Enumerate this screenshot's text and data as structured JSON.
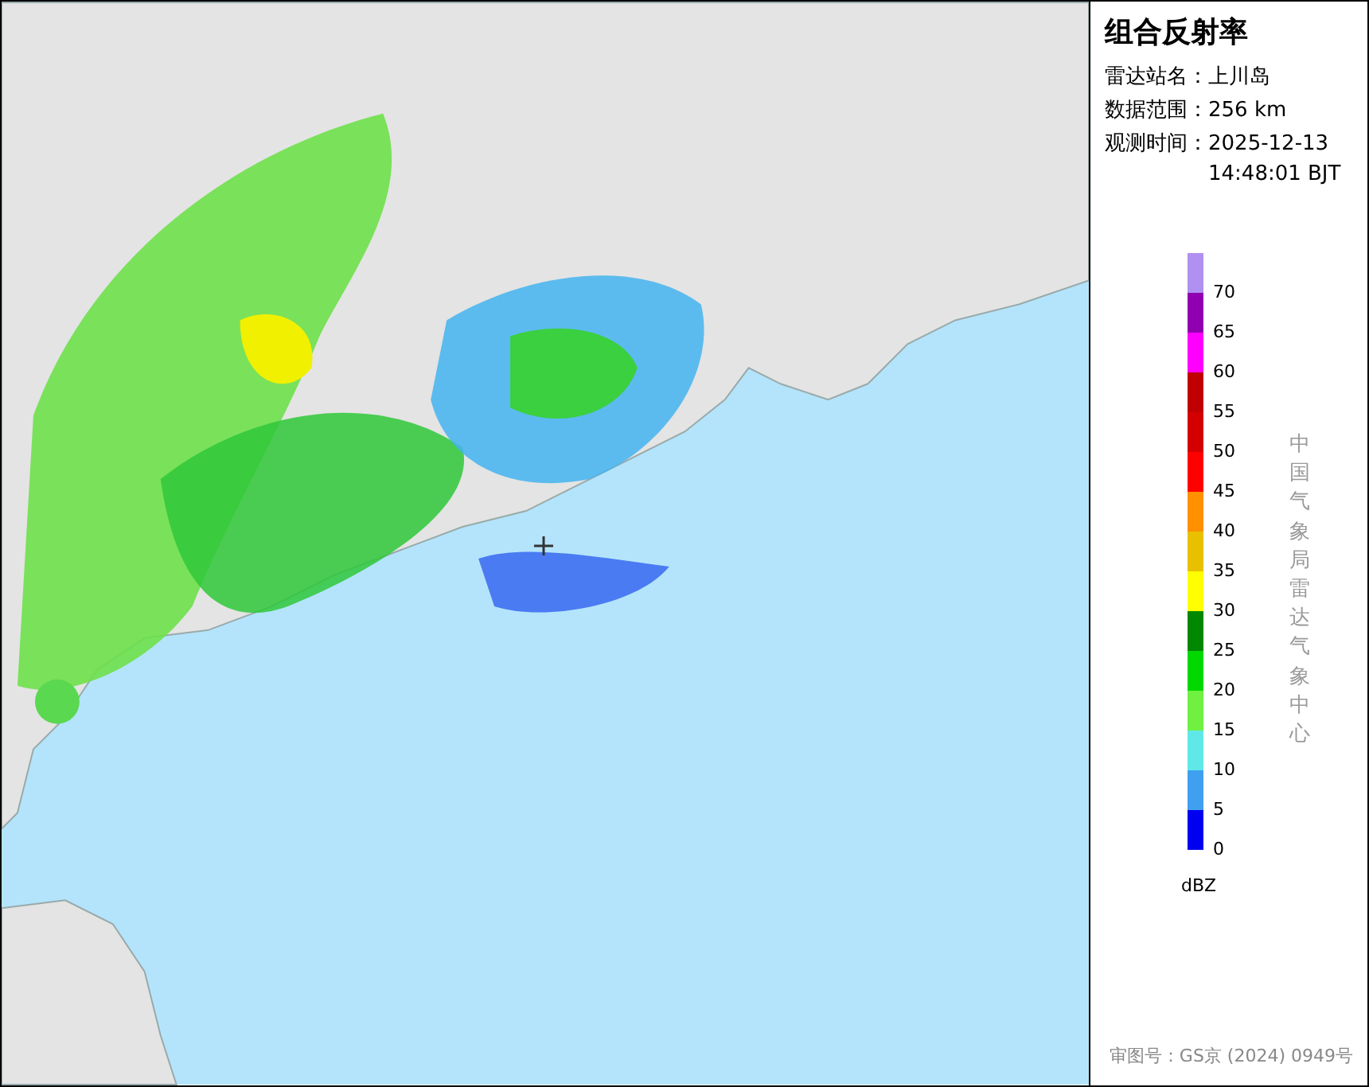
{
  "panel": {
    "title": "组合反射率",
    "info": [
      {
        "label": "雷达站名：",
        "value": "上川岛"
      },
      {
        "label": "数据范围：",
        "value": "256 km"
      },
      {
        "label": "观测时间：",
        "value": "2025-12-13 14:48:01 BJT"
      }
    ],
    "legend": {
      "bins": [
        {
          "color": "#b090f0"
        },
        {
          "color": "#9000b0"
        },
        {
          "color": "#ff00ff"
        },
        {
          "color": "#c00000"
        },
        {
          "color": "#d40000"
        },
        {
          "color": "#ff0000"
        },
        {
          "color": "#ff9000"
        },
        {
          "color": "#e8c000"
        },
        {
          "color": "#ffff00"
        },
        {
          "color": "#008800"
        },
        {
          "color": "#00d800"
        },
        {
          "color": "#70f040"
        },
        {
          "color": "#60e8e8"
        },
        {
          "color": "#40a0f0"
        },
        {
          "color": "#0000f0"
        }
      ],
      "labels": [
        "70",
        "65",
        "60",
        "55",
        "50",
        "45",
        "40",
        "35",
        "30",
        "25",
        "20",
        "15",
        "10",
        "5",
        "0"
      ],
      "unit": "dBZ"
    },
    "credit": "中国气象局雷达气象中心",
    "approval": "审图号：GS京 (2024) 0949号"
  }
}
